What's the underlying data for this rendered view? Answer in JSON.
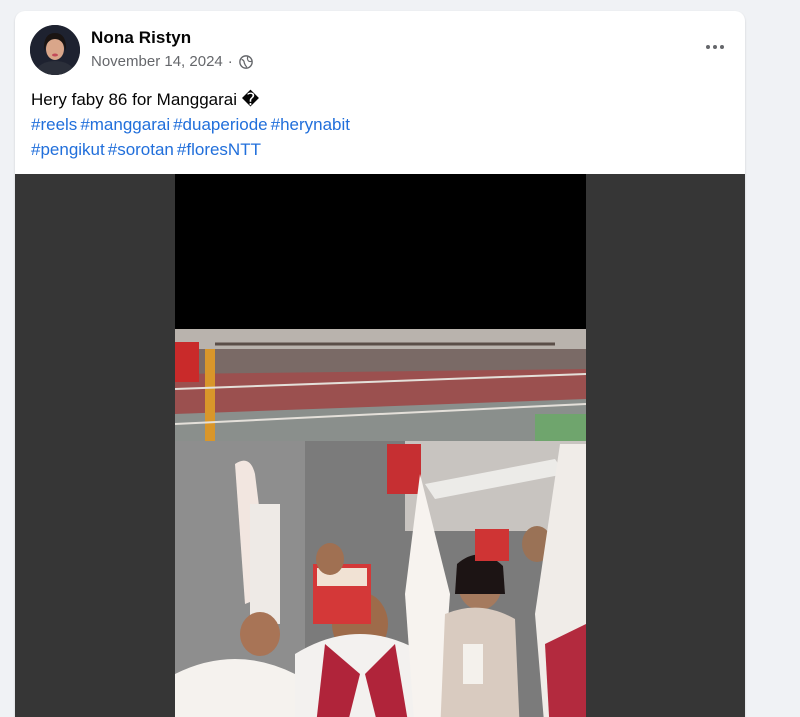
{
  "post": {
    "author": "Nona Ristyn",
    "date": "November 14, 2024",
    "separator": "·",
    "privacy_icon": "globe-icon",
    "more_icon": "more-options-icon",
    "caption": "Hery faby 86 for Manggarai �",
    "hashtags_line1": [
      "#reels",
      "#manggarai",
      "#duaperiode",
      "#herynabit"
    ],
    "hashtags_line2": [
      "#pengikut",
      "#sorotan",
      "#floresNTT"
    ]
  },
  "colors": {
    "link": "#216fdb",
    "secondary_text": "#65676b",
    "media_background": "#363636"
  }
}
